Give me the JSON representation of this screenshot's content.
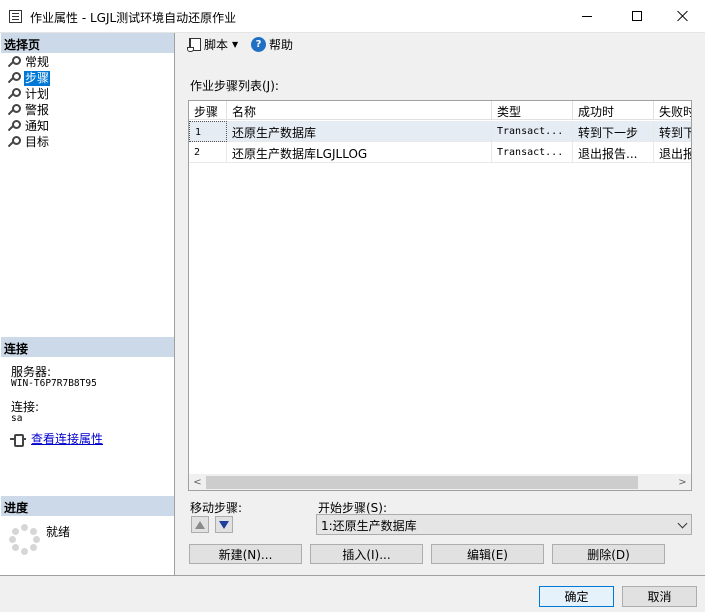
{
  "window": {
    "title": "作业属性 - LGJL测试环境自动还原作业",
    "icon": "properties-window-icon"
  },
  "left_panel": {
    "select_page_header": "选择页",
    "nav_items": [
      {
        "label": "常规",
        "icon": "wrench-icon",
        "selected": false
      },
      {
        "label": "步骤",
        "icon": "wrench-icon",
        "selected": true
      },
      {
        "label": "计划",
        "icon": "wrench-icon",
        "selected": false
      },
      {
        "label": "警报",
        "icon": "wrench-icon",
        "selected": false
      },
      {
        "label": "通知",
        "icon": "wrench-icon",
        "selected": false
      },
      {
        "label": "目标",
        "icon": "wrench-icon",
        "selected": false
      }
    ],
    "connection": {
      "header": "连接",
      "server_label": "服务器:",
      "server_value": "WIN-T6P7R7B8T95",
      "connection_label": "连接:",
      "connection_value": "sa",
      "view_link": "查看连接属性"
    },
    "progress": {
      "header": "进度",
      "status": "就绪"
    }
  },
  "toolbar": {
    "script_label": "脚本",
    "help_label": "帮助"
  },
  "steps": {
    "title": "作业步骤列表(J):",
    "columns": [
      "步骤",
      "名称",
      "类型",
      "成功时",
      "失败时"
    ],
    "rows": [
      {
        "step": "1",
        "name": "还原生产数据库",
        "type": "Transact...",
        "on_success": "转到下一步",
        "on_failure": "转到下"
      },
      {
        "step": "2",
        "name": "还原生产数据库LGJLLOG",
        "type": "Transact...",
        "on_success": "退出报告...",
        "on_failure": "退出报"
      }
    ]
  },
  "move_step_label": "移动步骤:",
  "start_step": {
    "label": "开始步骤(S):",
    "value": "1:还原生产数据库"
  },
  "buttons": {
    "new": "新建(N)...",
    "insert": "插入(I)...",
    "edit": "编辑(E)",
    "delete": "删除(D)",
    "ok": "确定",
    "cancel": "取消"
  },
  "colors": {
    "selection": "#0078d7",
    "section_header": "#ccd9e8",
    "link": "#0000cc"
  }
}
